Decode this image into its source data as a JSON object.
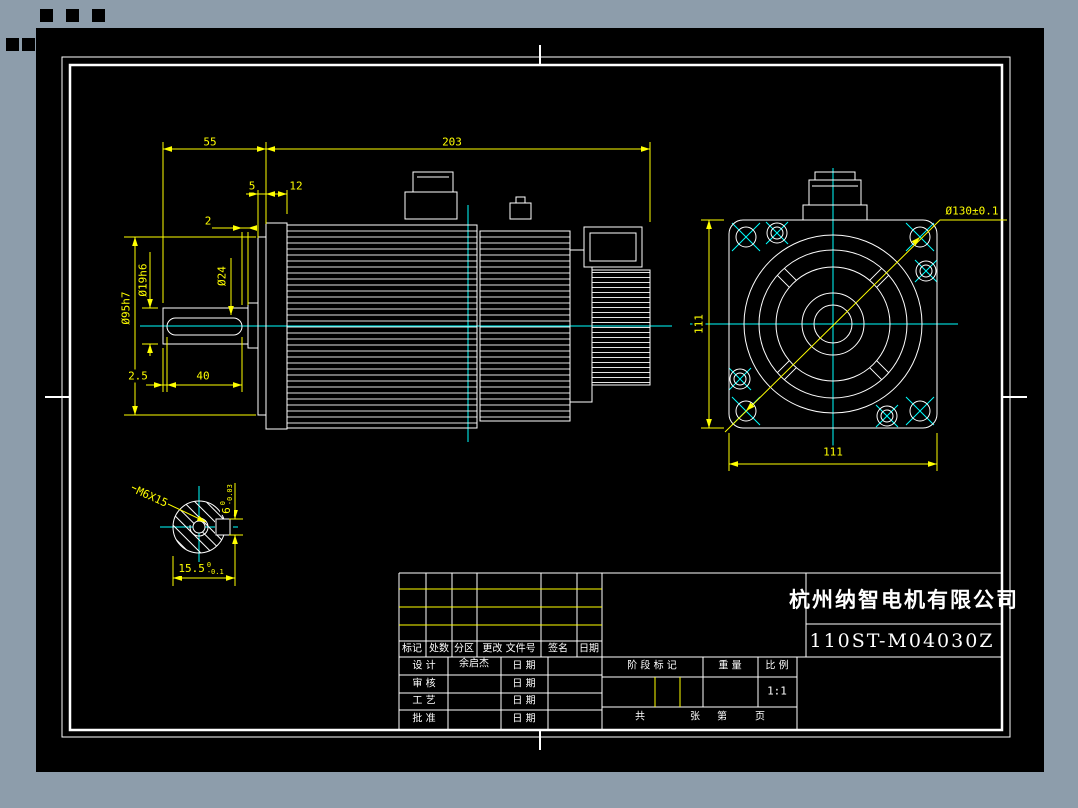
{
  "page": {
    "background": "#8d9dab",
    "canvas_color": "#000000",
    "geometry_color": "#ffffff",
    "dimension_color": "#ffff00",
    "centerline_color": "#00ffff"
  },
  "views": {
    "side": {
      "dims": {
        "shaft_len": "55",
        "body_len": "203",
        "spigot_depth": "5",
        "flange_thick": "12",
        "key_gap": "2",
        "dia_step": "Ø24",
        "dia_shaft": "Ø19h6",
        "dia_spigot": "Ø95h7",
        "key_start": "2.5",
        "key_len": "40"
      }
    },
    "front": {
      "dims": {
        "bolt_circle": "Ø130±0.1",
        "flange_width": "111",
        "flange_height": "111"
      }
    },
    "section": {
      "dims": {
        "thread_callout": "M6X15",
        "flat_value": "15.5",
        "flat_tol_upper": "0",
        "flat_tol_lower": "-0.1",
        "key_width": "6",
        "key_tol_upper": "0",
        "key_tol_lower": "-0.03"
      }
    }
  },
  "title_block": {
    "company": "杭州纳智电机有限公司",
    "model": "110ST-M04030Z",
    "revision_header": [
      "标记",
      "处数",
      "分区",
      "更改 文件号",
      "签名",
      "日期"
    ],
    "sign_rows": [
      {
        "label": "设 计",
        "name": "余启杰",
        "date_label": "日 期"
      },
      {
        "label": "审 核",
        "name": "",
        "date_label": "日 期"
      },
      {
        "label": "工 艺",
        "name": "",
        "date_label": "日 期"
      },
      {
        "label": "批 准",
        "name": "",
        "date_label": "日 期"
      }
    ],
    "stage_label": "阶 段 标 记",
    "weight_label": "重 量",
    "scale_label": "比 例",
    "scale_value": "1:1",
    "sheet_total_label": "共",
    "sheet_total_unit": "张",
    "sheet_no_label": "第",
    "sheet_no_unit": "页"
  }
}
